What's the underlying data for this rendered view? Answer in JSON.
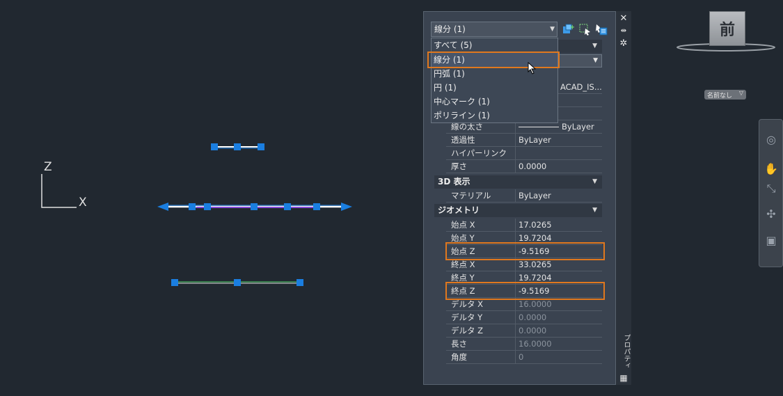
{
  "viewport": {
    "ucs_z": "Z",
    "ucs_x": "X"
  },
  "viewcube": {
    "face_label": "前",
    "named_view": "名前なし"
  },
  "palette": {
    "title": "プロパティ",
    "object_select": "線分 (1)",
    "dropdown": [
      "すべて (5)",
      "線分 (1)",
      "円弧 (1)",
      "円 (1)",
      "中心マーク (1)",
      "ポリライン (1)"
    ],
    "partial_values": {
      "linetype": "ACAD_IS..."
    },
    "general_rows": [
      {
        "label": "線の太さ",
        "value": "ByLayer"
      },
      {
        "label": "透過性",
        "value": "ByLayer"
      },
      {
        "label": "ハイパーリンク",
        "value": ""
      },
      {
        "label": "厚さ",
        "value": "0.0000"
      }
    ],
    "section_3d": "3D 表示",
    "rows_3d": [
      {
        "label": "マテリアル",
        "value": "ByLayer"
      }
    ],
    "section_geometry": "ジオメトリ",
    "geometry_rows": [
      {
        "label": "始点 X",
        "value": "17.0265",
        "dim": false
      },
      {
        "label": "始点 Y",
        "value": "19.7204",
        "dim": false
      },
      {
        "label": "始点 Z",
        "value": "-9.5169",
        "dim": false
      },
      {
        "label": "終点 X",
        "value": "33.0265",
        "dim": false
      },
      {
        "label": "終点 Y",
        "value": "19.7204",
        "dim": false
      },
      {
        "label": "終点 Z",
        "value": "-9.5169",
        "dim": false
      },
      {
        "label": "デルタ X",
        "value": "16.0000",
        "dim": true
      },
      {
        "label": "デルタ Y",
        "value": "0.0000",
        "dim": true
      },
      {
        "label": "デルタ Z",
        "value": "0.0000",
        "dim": true
      },
      {
        "label": "長さ",
        "value": "16.0000",
        "dim": true
      },
      {
        "label": "角度",
        "value": "0",
        "dim": true
      }
    ]
  },
  "colors": {
    "background": "#212830",
    "grip": "#1a7ee0",
    "highlight": "#e0781e",
    "palette": "#3a4350"
  }
}
